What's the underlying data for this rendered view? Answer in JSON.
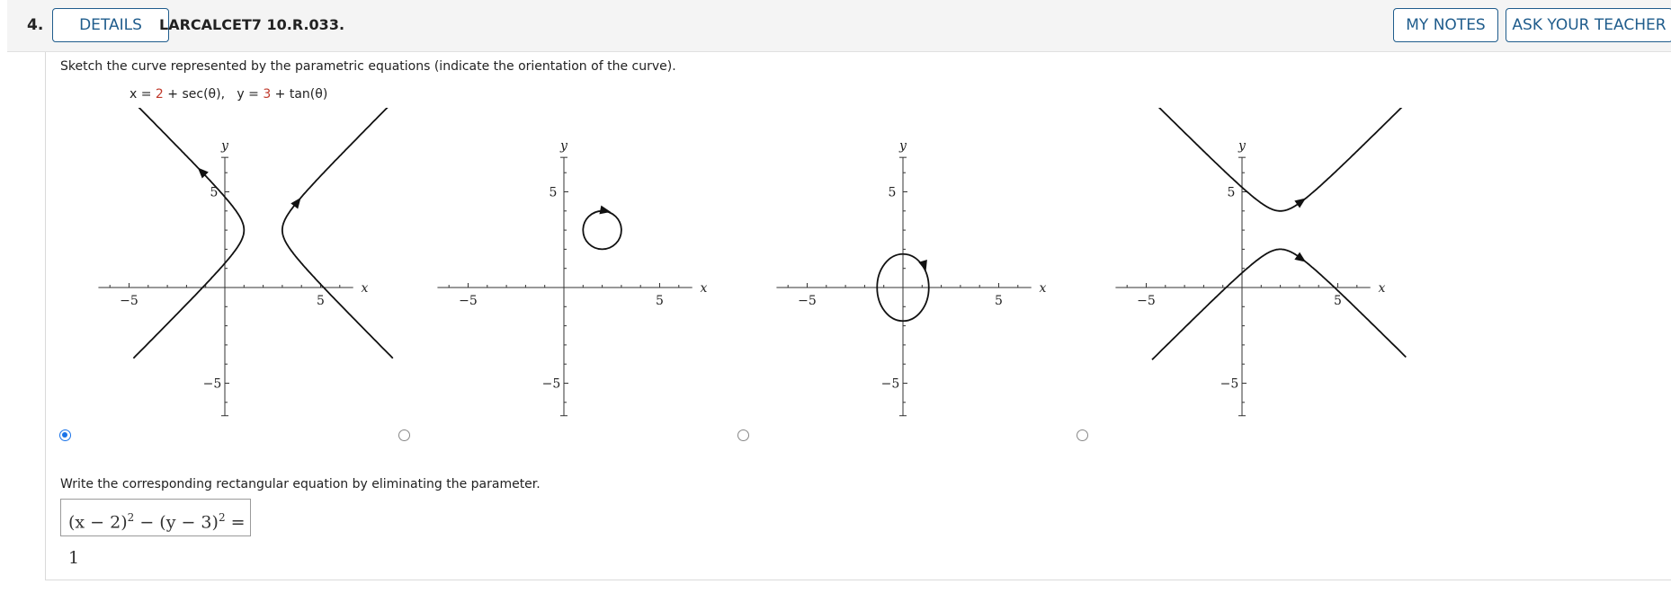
{
  "header": {
    "question_number": "4.",
    "details_label": "DETAILS",
    "problem_code": "LARCALCET7 10.R.033.",
    "my_notes_label": "MY NOTES",
    "ask_teacher_label": "ASK YOUR TEACHER"
  },
  "question": {
    "prompt": "Sketch the curve represented by the parametric equations (indicate the orientation of the curve).",
    "eq_x_label": "x = ",
    "eq_x_const": "2",
    "eq_x_rest": " + sec(θ),",
    "eq_y_label": "y = ",
    "eq_y_const": "3",
    "eq_y_rest": " + tan(θ)",
    "graph_labels": {
      "x": "x",
      "y": "y",
      "neg5": "−5",
      "pos5": "5"
    },
    "options": [
      {
        "id": "A",
        "curve": "hyperbola-horizontal",
        "selected": true
      },
      {
        "id": "B",
        "curve": "circle-small",
        "selected": false
      },
      {
        "id": "C",
        "curve": "ellipse-origin",
        "selected": false
      },
      {
        "id": "D",
        "curve": "hyperbola-vertical",
        "selected": false
      }
    ],
    "prompt2": "Write the corresponding rectangular equation by eliminating the parameter.",
    "answer": {
      "lhs1": "(x − 2)",
      "exp1": "2",
      "mid": " − (y − 3)",
      "exp2": "2",
      "rhs": " = 1"
    },
    "colors": {
      "accent": "#1f5c8c",
      "radio_selected": "#1a73e8",
      "constant_red": "#c0392b"
    }
  }
}
